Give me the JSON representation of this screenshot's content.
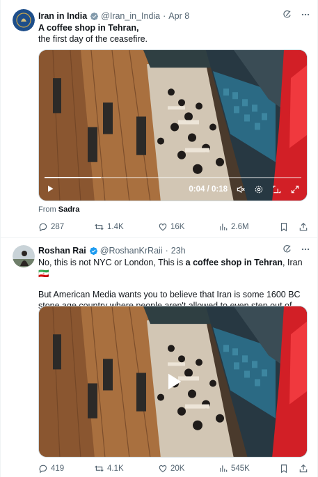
{
  "tweets": [
    {
      "name": "Iran in India",
      "handle": "@Iran_in_India",
      "time": "Apr 8",
      "dot": "·",
      "text_bold": "A coffee shop in Tehran,",
      "text_line2": "the first day of the ceasefire.",
      "video": {
        "time": "0:04 / 0:18",
        "progress": 0.22,
        "state": "playing"
      },
      "from_label": "From",
      "from_name": "Sadra",
      "stats": {
        "replies": "287",
        "reposts": "1.4K",
        "likes": "16K",
        "views": "2.6M"
      }
    },
    {
      "name": "Roshan Rai",
      "handle": "@RoshanKrRaii",
      "time": "23h",
      "dot": "·",
      "text_pre": "No, this is not NYC or London, This is ",
      "text_bold": "a coffee shop in Tehran",
      "text_post": ", Iran ",
      "flag": "🇮🇷",
      "text_para2": "But American Media wants you to believe that Iran is some 1600 BC stone age country where people aren't allowed to even step out of their homes.",
      "video": {
        "state": "paused"
      },
      "stats": {
        "replies": "419",
        "reposts": "4.1K",
        "likes": "20K",
        "views": "545K"
      }
    }
  ],
  "colors": {
    "verified": "#1d9bf0",
    "muted": "#536471",
    "text": "#0f1419",
    "border": "#eff3f4"
  },
  "icons": [
    "grok-icon",
    "more-icon",
    "verified-icon",
    "play-icon",
    "volume-icon",
    "settings-icon",
    "pip-icon",
    "fullscreen-icon",
    "reply-icon",
    "repost-icon",
    "like-icon",
    "views-icon",
    "bookmark-icon",
    "share-icon"
  ]
}
